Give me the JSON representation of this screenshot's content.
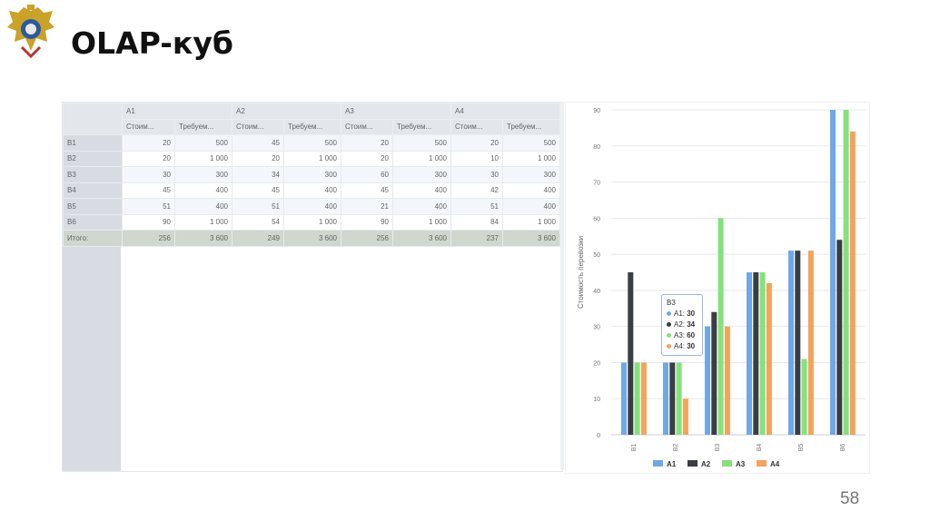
{
  "slide": {
    "title": "OLAP-куб",
    "page_number": "58"
  },
  "table": {
    "column_groups": [
      "A1",
      "A2",
      "A3",
      "A4"
    ],
    "subheaders": [
      "Стоим...",
      "Требуем..."
    ],
    "rows": [
      {
        "label": "B1",
        "values": [
          "20",
          "500",
          "45",
          "500",
          "20",
          "500",
          "20",
          "500"
        ]
      },
      {
        "label": "B2",
        "values": [
          "20",
          "1 000",
          "20",
          "1 000",
          "20",
          "1 000",
          "10",
          "1 000"
        ]
      },
      {
        "label": "B3",
        "values": [
          "30",
          "300",
          "34",
          "300",
          "60",
          "300",
          "30",
          "300"
        ]
      },
      {
        "label": "B4",
        "values": [
          "45",
          "400",
          "45",
          "400",
          "45",
          "400",
          "42",
          "400"
        ]
      },
      {
        "label": "B5",
        "values": [
          "51",
          "400",
          "51",
          "400",
          "21",
          "400",
          "51",
          "400"
        ]
      },
      {
        "label": "B6",
        "values": [
          "90",
          "1 000",
          "54",
          "1 000",
          "90",
          "1 000",
          "84",
          "1 000"
        ]
      }
    ],
    "total": {
      "label": "Итого:",
      "values": [
        "256",
        "3 600",
        "249",
        "3 600",
        "256",
        "3 600",
        "237",
        "3 600"
      ]
    }
  },
  "chart_data": {
    "type": "bar",
    "categories": [
      "B1",
      "B2",
      "B3",
      "B4",
      "B5",
      "B6"
    ],
    "series": [
      {
        "name": "A1",
        "color": "#6fa8e6",
        "values": [
          20,
          20,
          30,
          45,
          51,
          90
        ]
      },
      {
        "name": "A2",
        "color": "#3a3d44",
        "values": [
          45,
          20,
          34,
          45,
          51,
          54
        ]
      },
      {
        "name": "A3",
        "color": "#84e27a",
        "values": [
          20,
          20,
          60,
          45,
          21,
          90
        ]
      },
      {
        "name": "A4",
        "color": "#f4a25c",
        "values": [
          20,
          10,
          30,
          42,
          51,
          84
        ]
      }
    ],
    "ylabel": "Стоимость перевозки",
    "ylim": [
      0,
      90
    ],
    "yticks": [
      0,
      10,
      20,
      30,
      40,
      50,
      60,
      70,
      80,
      90
    ],
    "grid": true,
    "legend": "bottom",
    "tooltip": {
      "title": "B3",
      "items": [
        {
          "label": "A1: ",
          "value": "30"
        },
        {
          "label": "A2: ",
          "value": "34"
        },
        {
          "label": "A3: ",
          "value": "60"
        },
        {
          "label": "A4: ",
          "value": "30"
        }
      ]
    }
  }
}
